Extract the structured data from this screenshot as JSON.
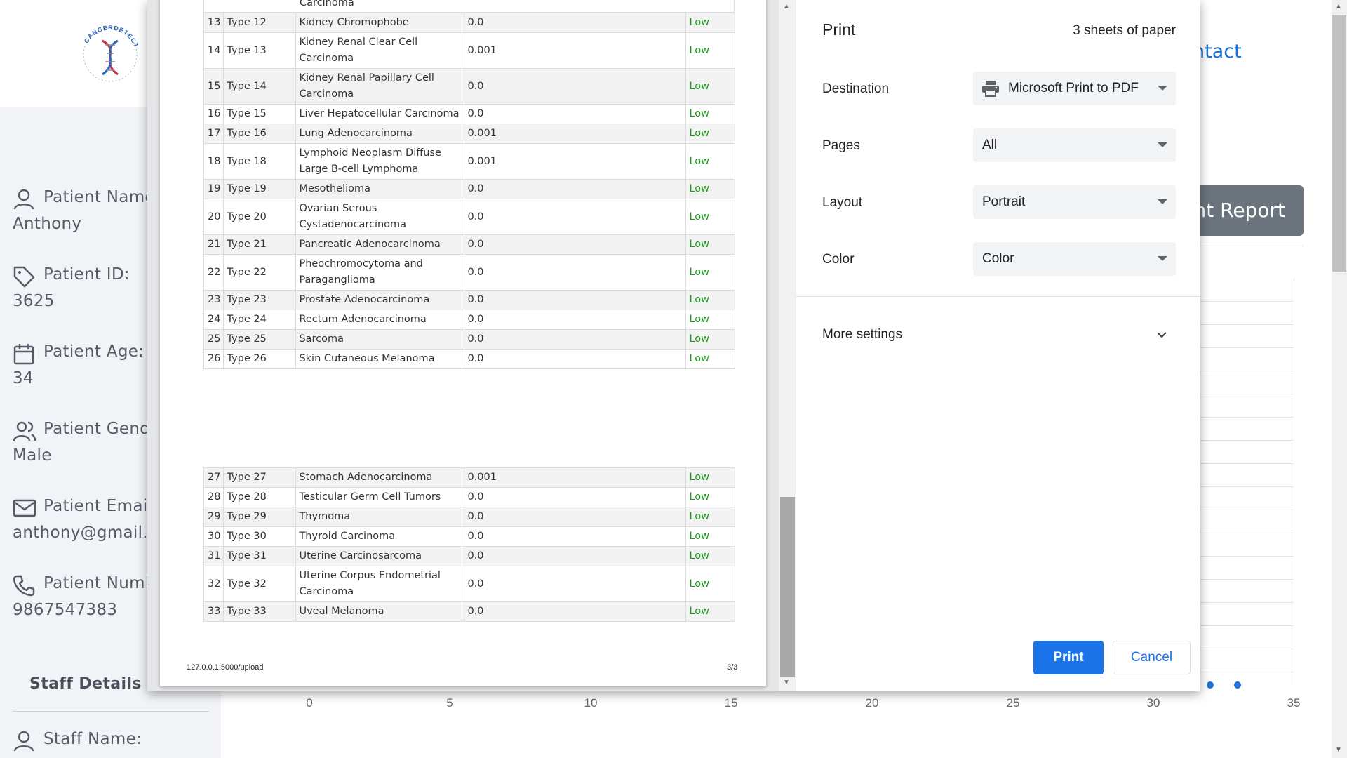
{
  "background": {
    "logo_text": "CANCERDETECT",
    "patient": {
      "name_label": "Patient Name:",
      "name_value": "Anthony",
      "id_label": "Patient ID:",
      "id_value": "3625",
      "age_label": "Patient Age:",
      "age_value": "34",
      "gender_label": "Patient Gender:",
      "gender_value": "Male",
      "email_label": "Patient Email:",
      "email_value": "anthony@gmail.com",
      "number_label": "Patient Number:",
      "number_value": "9867547383"
    },
    "staff": {
      "title": "Staff Details",
      "name_label": "Staff Name:"
    },
    "contact_link": "ntact",
    "report_button": "nt Report",
    "chart_ticks": [
      "0",
      "5",
      "10",
      "15",
      "20",
      "25",
      "30",
      "35"
    ],
    "accent_color": "#1f6ed4"
  },
  "preview": {
    "partial_top_text": "Carcinoma",
    "table_part1": [
      {
        "num": "13",
        "type": "Type 12",
        "name": "Kidney Chromophobe",
        "prob": "0.0",
        "risk": "Low"
      },
      {
        "num": "14",
        "type": "Type 13",
        "name": "Kidney Renal Clear Cell Carcinoma",
        "prob": "0.001",
        "risk": "Low"
      },
      {
        "num": "15",
        "type": "Type 14",
        "name": "Kidney Renal Papillary Cell Carcinoma",
        "prob": "0.0",
        "risk": "Low"
      },
      {
        "num": "16",
        "type": "Type 15",
        "name": "Liver Hepatocellular Carcinoma",
        "prob": "0.0",
        "risk": "Low"
      },
      {
        "num": "17",
        "type": "Type 16",
        "name": "Lung Adenocarcinoma",
        "prob": "0.001",
        "risk": "Low"
      },
      {
        "num": "18",
        "type": "Type 18",
        "name": "Lymphoid Neoplasm Diffuse Large B-cell Lymphoma",
        "prob": "0.001",
        "risk": "Low"
      },
      {
        "num": "19",
        "type": "Type 19",
        "name": "Mesothelioma",
        "prob": "0.0",
        "risk": "Low"
      },
      {
        "num": "20",
        "type": "Type 20",
        "name": "Ovarian Serous Cystadenocarcinoma",
        "prob": "0.0",
        "risk": "Low"
      },
      {
        "num": "21",
        "type": "Type 21",
        "name": "Pancreatic Adenocarcinoma",
        "prob": "0.0",
        "risk": "Low"
      },
      {
        "num": "22",
        "type": "Type 22",
        "name": "Pheochromocytoma and Paraganglioma",
        "prob": "0.0",
        "risk": "Low"
      },
      {
        "num": "23",
        "type": "Type 23",
        "name": "Prostate Adenocarcinoma",
        "prob": "0.0",
        "risk": "Low"
      },
      {
        "num": "24",
        "type": "Type 24",
        "name": "Rectum Adenocarcinoma",
        "prob": "0.0",
        "risk": "Low"
      },
      {
        "num": "25",
        "type": "Type 25",
        "name": "Sarcoma",
        "prob": "0.0",
        "risk": "Low"
      },
      {
        "num": "26",
        "type": "Type 26",
        "name": "Skin Cutaneous Melanoma",
        "prob": "0.0",
        "risk": "Low"
      }
    ],
    "table_part2": [
      {
        "num": "27",
        "type": "Type 27",
        "name": "Stomach Adenocarcinoma",
        "prob": "0.001",
        "risk": "Low"
      },
      {
        "num": "28",
        "type": "Type 28",
        "name": "Testicular Germ Cell Tumors",
        "prob": "0.0",
        "risk": "Low"
      },
      {
        "num": "29",
        "type": "Type 29",
        "name": "Thymoma",
        "prob": "0.0",
        "risk": "Low"
      },
      {
        "num": "30",
        "type": "Type 30",
        "name": "Thyroid Carcinoma",
        "prob": "0.0",
        "risk": "Low"
      },
      {
        "num": "31",
        "type": "Type 31",
        "name": "Uterine Carcinosarcoma",
        "prob": "0.0",
        "risk": "Low"
      },
      {
        "num": "32",
        "type": "Type 32",
        "name": "Uterine Corpus Endometrial Carcinoma",
        "prob": "0.0",
        "risk": "Low"
      },
      {
        "num": "33",
        "type": "Type 33",
        "name": "Uveal Melanoma",
        "prob": "0.0",
        "risk": "Low"
      }
    ],
    "footer_url": "127.0.0.1:5000/upload",
    "footer_page": "3/3",
    "risk_color": "#1e9a1e"
  },
  "print_settings": {
    "title": "Print",
    "sheet_count": "3 sheets of paper",
    "destination_label": "Destination",
    "destination_value": "Microsoft Print to PDF",
    "pages_label": "Pages",
    "pages_value": "All",
    "layout_label": "Layout",
    "layout_value": "Portrait",
    "color_label": "Color",
    "color_value": "Color",
    "more_settings": "More settings",
    "print_button": "Print",
    "cancel_button": "Cancel",
    "primary_color": "#1a73e8"
  }
}
